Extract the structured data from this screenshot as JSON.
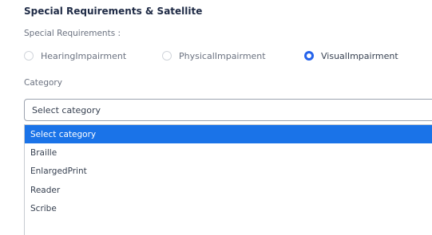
{
  "section": {
    "title": "Special Requirements & Satellite"
  },
  "special_requirements": {
    "label": "Special Requirements :",
    "options": [
      {
        "label": "HearingImpairment",
        "checked": false
      },
      {
        "label": "PhysicalImpairment",
        "checked": false
      },
      {
        "label": "VisualImpairment",
        "checked": true
      }
    ]
  },
  "category": {
    "label": "Category",
    "selected_value": "Select category",
    "options": [
      {
        "label": "Select category",
        "highlighted": true
      },
      {
        "label": "Braille",
        "highlighted": false
      },
      {
        "label": "EnlargedPrint",
        "highlighted": false
      },
      {
        "label": "Reader",
        "highlighted": false
      },
      {
        "label": "Scribe",
        "highlighted": false
      }
    ]
  },
  "colors": {
    "accent": "#2563eb",
    "highlight": "#1a73e8",
    "title": "#1e2a45"
  }
}
